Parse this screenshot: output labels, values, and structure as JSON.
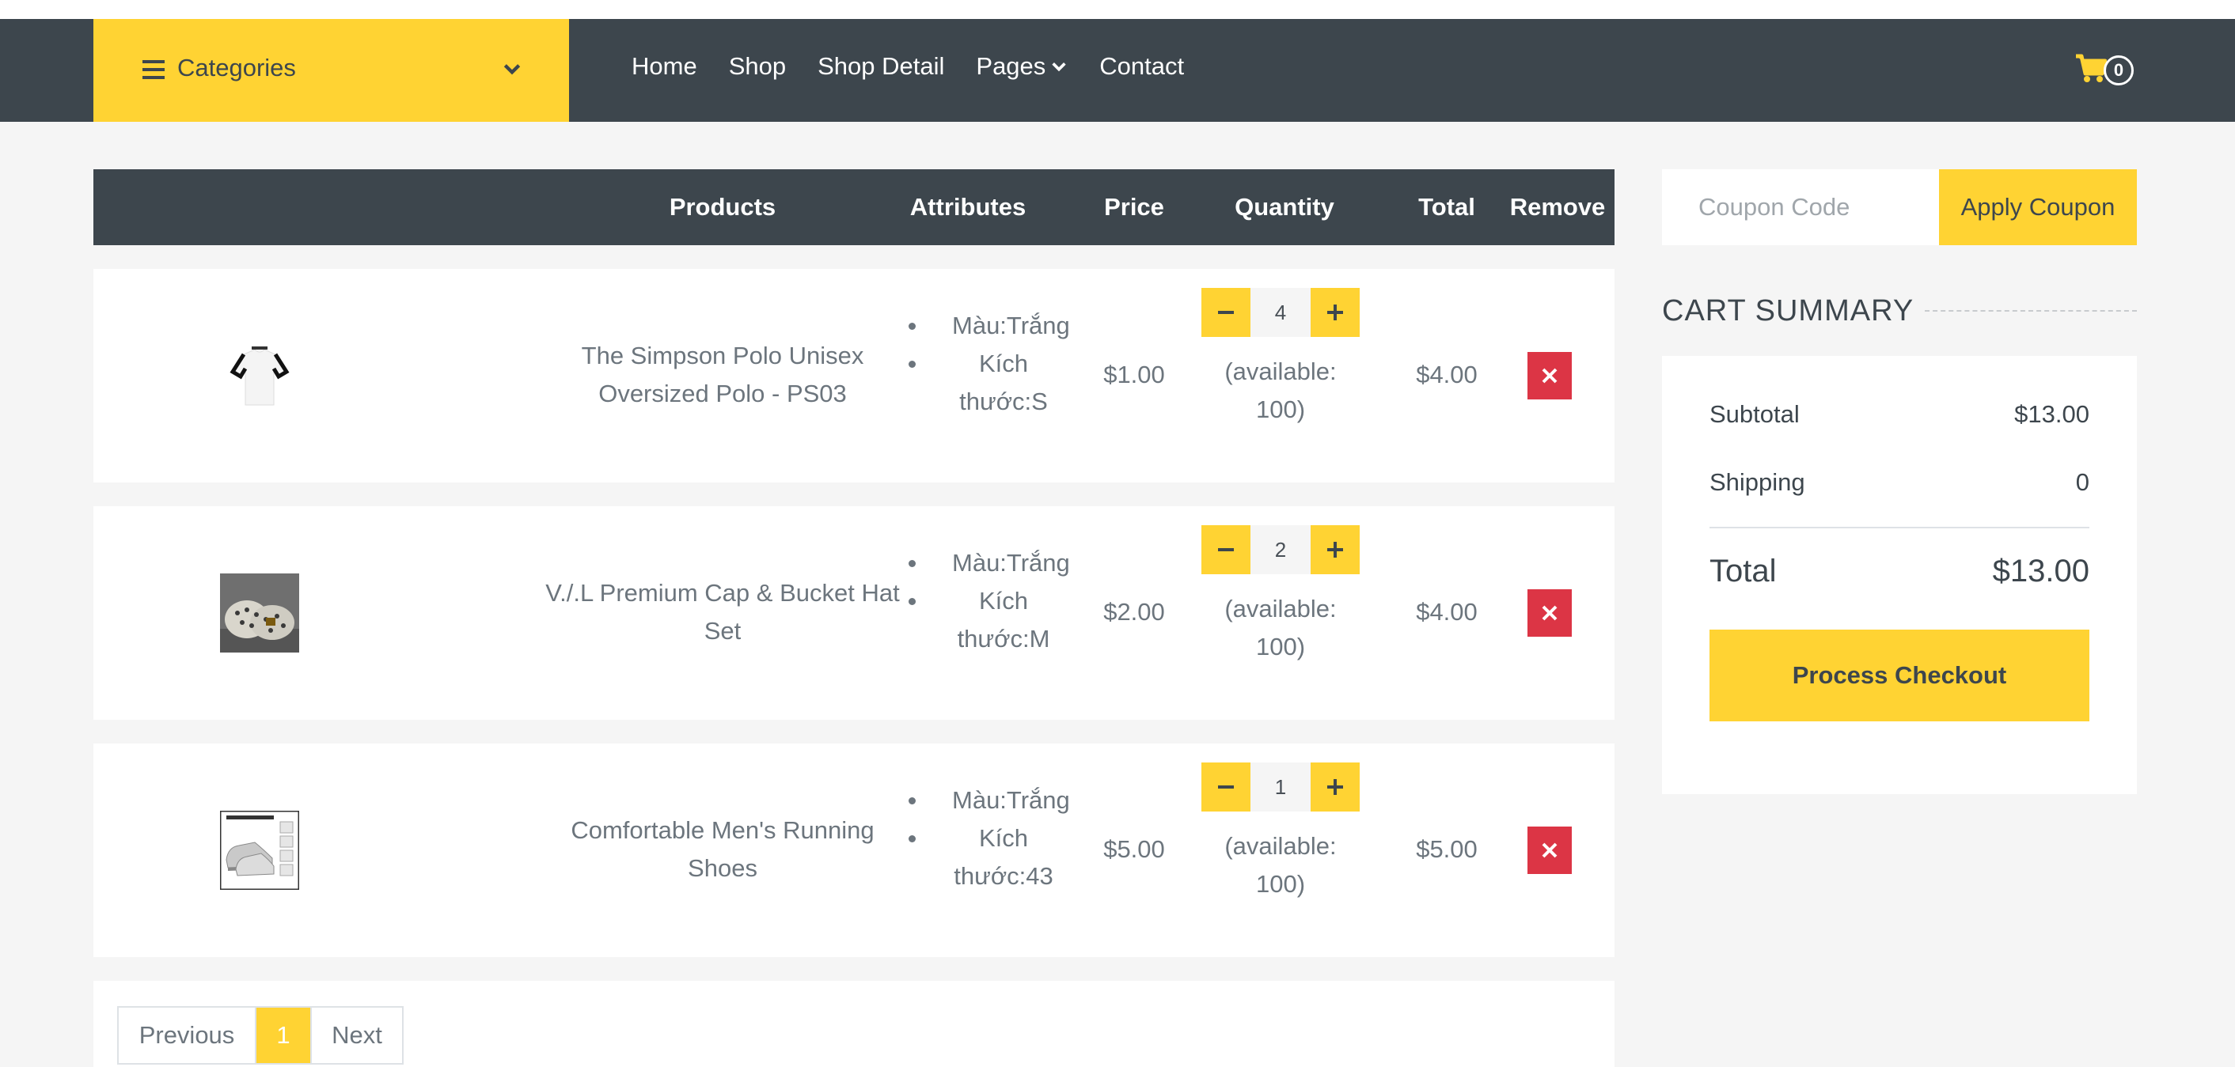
{
  "nav": {
    "categories_label": "Categories",
    "links": [
      "Home",
      "Shop",
      "Shop Detail",
      "Pages",
      "Contact"
    ],
    "cart_count": "0"
  },
  "table": {
    "headers": {
      "products": "Products",
      "attributes": "Attributes",
      "price": "Price",
      "quantity": "Quantity",
      "total": "Total",
      "remove": "Remove"
    },
    "rows": [
      {
        "name": "The Simpson Polo Unisex Oversized Polo - PS03",
        "name_line1": "The Simpson Polo Unisex",
        "name_line2": "Oversized Polo - PS03",
        "attr_color": "Màu:Trắng",
        "attr_size_1": "Kích",
        "attr_size_2": "thước:S",
        "price": "$1.00",
        "qty": "4",
        "avail_1": "(available:",
        "avail_2": "100)",
        "total": "$4.00",
        "image": "polo-shirt-image"
      },
      {
        "name": "V./.L Premium Cap & Bucket Hat Set",
        "name_line1": "V./.L Premium Cap & Bucket Hat",
        "name_line2": "Set",
        "attr_color": "Màu:Trắng",
        "attr_size_1": "Kích",
        "attr_size_2": "thước:M",
        "price": "$2.00",
        "qty": "2",
        "avail_1": "(available:",
        "avail_2": "100)",
        "total": "$4.00",
        "image": "cap-hat-image"
      },
      {
        "name": "Comfortable Men's Running Shoes",
        "name_line1": "Comfortable Men's Running",
        "name_line2": "Shoes",
        "attr_color": "Màu:Trắng",
        "attr_size_1": "Kích",
        "attr_size_2": "thước:43",
        "price": "$5.00",
        "qty": "1",
        "avail_1": "(available:",
        "avail_2": "100)",
        "total": "$5.00",
        "image": "running-shoes-image"
      }
    ]
  },
  "pagination": {
    "prev": "Previous",
    "current": "1",
    "next": "Next"
  },
  "coupon": {
    "placeholder": "Coupon Code",
    "button": "Apply Coupon"
  },
  "summary": {
    "title": "CART SUMMARY",
    "subtotal_label": "Subtotal",
    "subtotal_value": "$13.00",
    "shipping_label": "Shipping",
    "shipping_value": "0",
    "total_label": "Total",
    "total_value": "$13.00",
    "checkout_label": "Process Checkout"
  },
  "colors": {
    "accent": "#ffd333",
    "dark": "#3d464d",
    "danger": "#dc3545",
    "background": "#f5f5f5"
  }
}
